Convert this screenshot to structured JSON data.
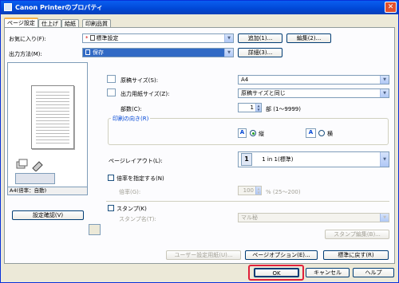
{
  "window": {
    "title": "Canon Printerのプロパティ",
    "close": "✕"
  },
  "tabs": [
    "ページ設定",
    "仕上げ",
    "給紙",
    "印刷品質"
  ],
  "favorites": {
    "label": "お気に入り(F):",
    "value": "標準設定",
    "add": "追加(1)...",
    "edit": "編集(2)..."
  },
  "output": {
    "label": "出力方法(M):",
    "value": "保存",
    "detail": "詳細(3)..."
  },
  "preview": {
    "status": "A4(倍率：自動)",
    "confirm_button": "設定確認(V)"
  },
  "page_size": {
    "label": "原稿サイズ(S):",
    "value": "A4"
  },
  "output_size": {
    "label": "出力用紙サイズ(Z):",
    "value": "原稿サイズと同じ"
  },
  "copies": {
    "label": "部数(C):",
    "value": "1",
    "unit": "部 (1～9999)"
  },
  "orientation": {
    "label": "印刷の向き(R)",
    "portrait": "縦",
    "landscape": "横",
    "portrait_icon": "A",
    "landscape_icon": "A"
  },
  "layout": {
    "label": "ページレイアウト(L):",
    "value": "1 in 1(標準)",
    "icon_number": "1"
  },
  "scaling": {
    "label": "倍率を指定する(N)",
    "sub_label": "倍率(G):",
    "value": "100",
    "unit": "% (25～200)"
  },
  "stamp": {
    "label": "スタンプ(K)",
    "sub_label": "スタンプ名(T):",
    "value": "マル秘",
    "edit": "スタンプ編集(B)..."
  },
  "bottom_buttons": {
    "user_paper": "ユーザー設定用紙(U)...",
    "page_options": "ページオプション(E)...",
    "reset": "標準に戻す(R)"
  },
  "dialog_buttons": {
    "ok": "OK",
    "cancel": "キャンセル",
    "help": "ヘルプ"
  },
  "colors": {
    "ok_highlight": "#e0203a",
    "title_bar": "#0054e3"
  }
}
